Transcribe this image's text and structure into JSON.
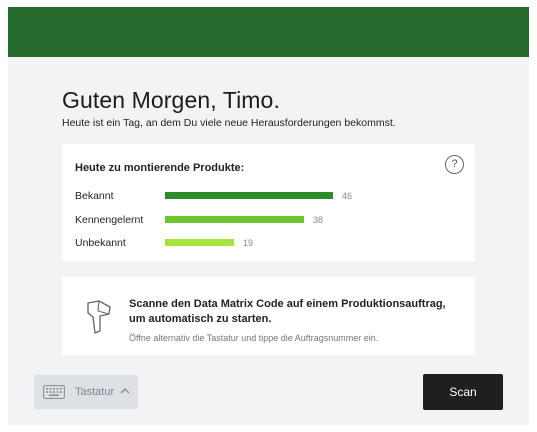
{
  "greeting": {
    "title": "Guten Morgen, Timo.",
    "subtitle": "Heute ist ein Tag, an dem Du viele neue Herausforderungen bekommst."
  },
  "products": {
    "title": "Heute zu montierende Produkte:",
    "help_icon": "question-circle-icon",
    "max_value": 46,
    "rows": [
      {
        "label": "Bekannt",
        "value": 46,
        "color": "#2e8b2a"
      },
      {
        "label": "Kennengelernt",
        "value": 38,
        "color": "#6cc52a"
      },
      {
        "label": "Unbekannt",
        "value": 19,
        "color": "#a4e33b"
      }
    ]
  },
  "scan_card": {
    "icon": "barcode-scanner-icon",
    "title": "Scanne den Data Matrix Code auf einem Produktionsauftrag, um automatisch zu starten.",
    "hint": "Öffne alternativ die Tastatur und tippe die Auftragsnummer ein."
  },
  "footer": {
    "keyboard_icon": "keyboard-icon",
    "keyboard_label": "Tastatur",
    "scan_label": "Scan"
  },
  "colors": {
    "header": "#266a2e",
    "background": "#f1f3f5",
    "primary_button": "#1f1f1f"
  }
}
